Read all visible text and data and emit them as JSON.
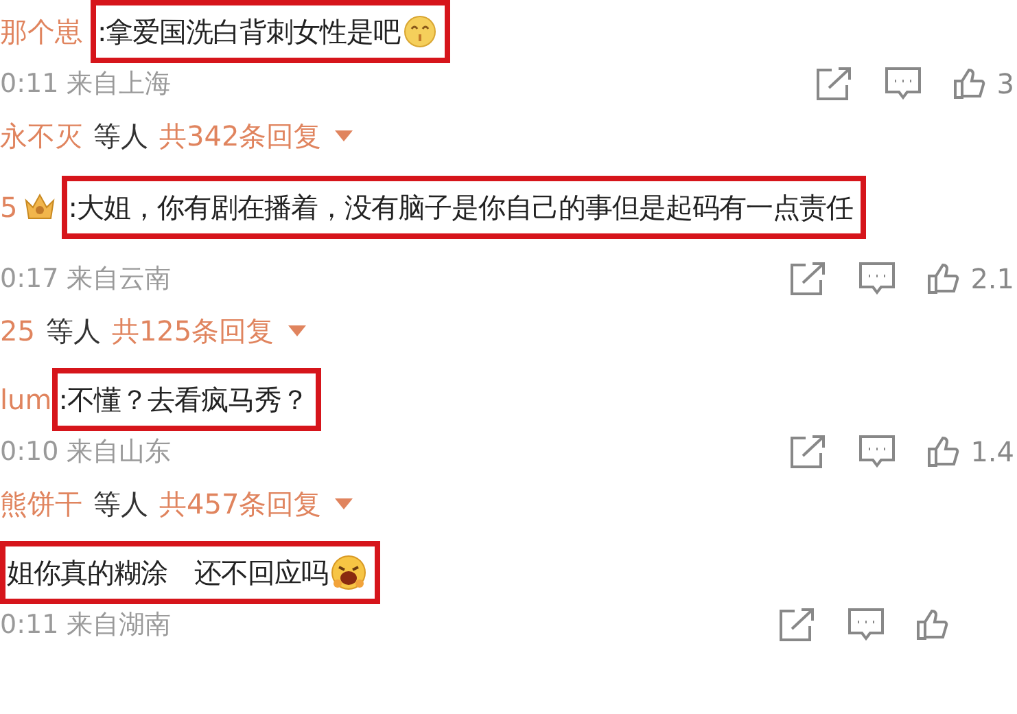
{
  "comments": [
    {
      "author": "那个崽",
      "author_badge": false,
      "text": ":拿爱国洗白背刺女性是吧",
      "emoji": true,
      "time": "0:11",
      "location": "来自上海",
      "likes": "3",
      "replies": {
        "names": "永不灭",
        "suffix": "等人",
        "count": "共342条回复"
      }
    },
    {
      "author": "5",
      "author_badge": true,
      "text": ":大姐，你有剧在播着，没有脑子是你自己的事但是起码有一点责任",
      "emoji": false,
      "time": "0:17",
      "location": "来自云南",
      "likes": "2.1",
      "replies": {
        "names": "25",
        "suffix": "等人",
        "count": "共125条回复"
      }
    },
    {
      "author": "lum",
      "author_badge": false,
      "text": ":不懂？去看疯马秀？",
      "emoji": false,
      "time": "0:10",
      "location": "来自山东",
      "likes": "1.4",
      "replies": {
        "names": "熊饼干",
        "suffix": "等人",
        "count": "共457条回复"
      }
    },
    {
      "text": "姐你真的糊涂　还不回应吗",
      "author_badge": false,
      "emoji": true,
      "time": "0:11",
      "location": "来自湖南"
    }
  ]
}
